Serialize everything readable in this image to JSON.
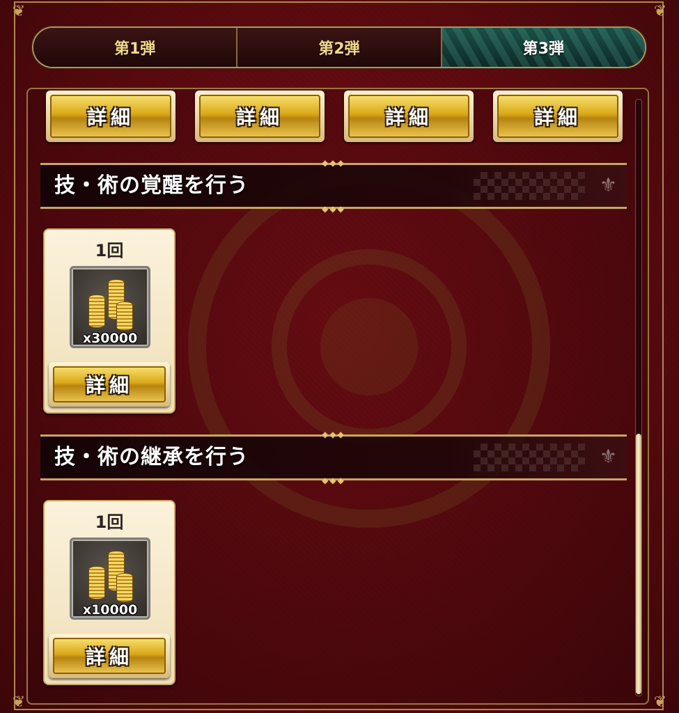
{
  "tabs": [
    {
      "label": "第1弾",
      "active": false
    },
    {
      "label": "第2弾",
      "active": false
    },
    {
      "label": "第3弾",
      "active": true
    }
  ],
  "top_buttons": [
    "詳細",
    "詳細",
    "詳細",
    "詳細"
  ],
  "sections": [
    {
      "title": "技・術の覚醒を行う",
      "reward": {
        "count": "1回",
        "item_icon": "gold-coins-icon",
        "quantity": "x30000",
        "button": "詳細"
      }
    },
    {
      "title": "技・術の継承を行う",
      "reward": {
        "count": "1回",
        "item_icon": "gold-coins-icon",
        "quantity": "x10000",
        "button": "詳細"
      }
    }
  ],
  "colors": {
    "background": "#5a0a0e",
    "active_tab": "#1b4f47",
    "gold": "#d9a818"
  },
  "scroll_position": 0.56
}
